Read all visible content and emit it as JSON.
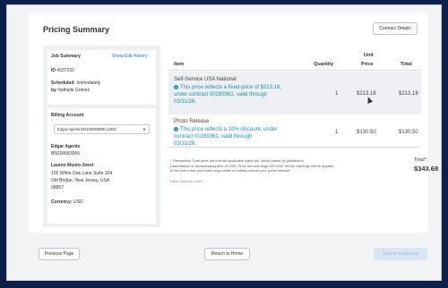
{
  "page": {
    "title": "Pricing Summary",
    "contract_details_label": "Contract Details"
  },
  "job_summary": {
    "heading": "Job Summary",
    "edit_history_link": "Show Edit History",
    "id_label": "ID",
    "id_value": "4337232",
    "scheduled_label": "Scheduled:",
    "scheduled_value": "Immediately",
    "by_label": "by",
    "by_value": "Nathalia Gomez"
  },
  "billing": {
    "heading": "Billing Account",
    "selected_account": "Edgar Agents BN100083995 (USD)",
    "company": "Edgar Agents",
    "account_number": "BN100083995",
    "contact_name": "Lauren Musto-Joest",
    "address_line1": "105 White Oak Lane Suite 104",
    "address_line2": "Old Bridge, New Jersey, USA",
    "zip": "08857",
    "currency_label": "Currency:",
    "currency_value": "USD"
  },
  "table": {
    "headers": {
      "item": "Item",
      "quantity": "Quantity",
      "unit_price_line1": "Unit",
      "unit_price_line2": "Price",
      "total": "Total"
    },
    "rows": [
      {
        "item": "Self-Service USA National",
        "note_line1": "This price reflects a fixed-price of $213.18,",
        "note_line2": "under contract 00289361, valid through",
        "note_line3": "03/31/26.",
        "quantity": "1",
        "unit_price": "$213.18",
        "total": "$213.18"
      },
      {
        "item": "Photo Release",
        "note_line1": "This price reflects a 10% discount, under",
        "note_line2": "contract 00289361, valid through",
        "note_line3": "03/31/26.",
        "quantity": "1",
        "unit_price": "$130.50",
        "total": "$130.50"
      }
    ]
  },
  "summary": {
    "footnote_line1": "* Transaction Total does not include applicable sales tax, which varies by jurisdiction.",
    "footnote_line2": "Cancellation or reprocessing fees of USD 75 for non-earnings OR USD 150 for earnings will be applied",
    "footnote_line3": "in the event that you make major edits or entirely cancel your press release.",
    "promo_link": "Have a promo code?",
    "total_label": "Total*:",
    "total_value": "$343.68"
  },
  "footer": {
    "previous_label": "Previous Page",
    "home_label": "Return to Home",
    "submit_label": "Submit to Editorial"
  },
  "colors": {
    "frame": "#0d1f4a",
    "link": "#1f7ab8",
    "note": "#1b8fb0",
    "disabled_button": "#d8e6f3"
  },
  "icons": [
    "info-icon",
    "chevron-down-icon",
    "mouse-cursor-icon"
  ]
}
